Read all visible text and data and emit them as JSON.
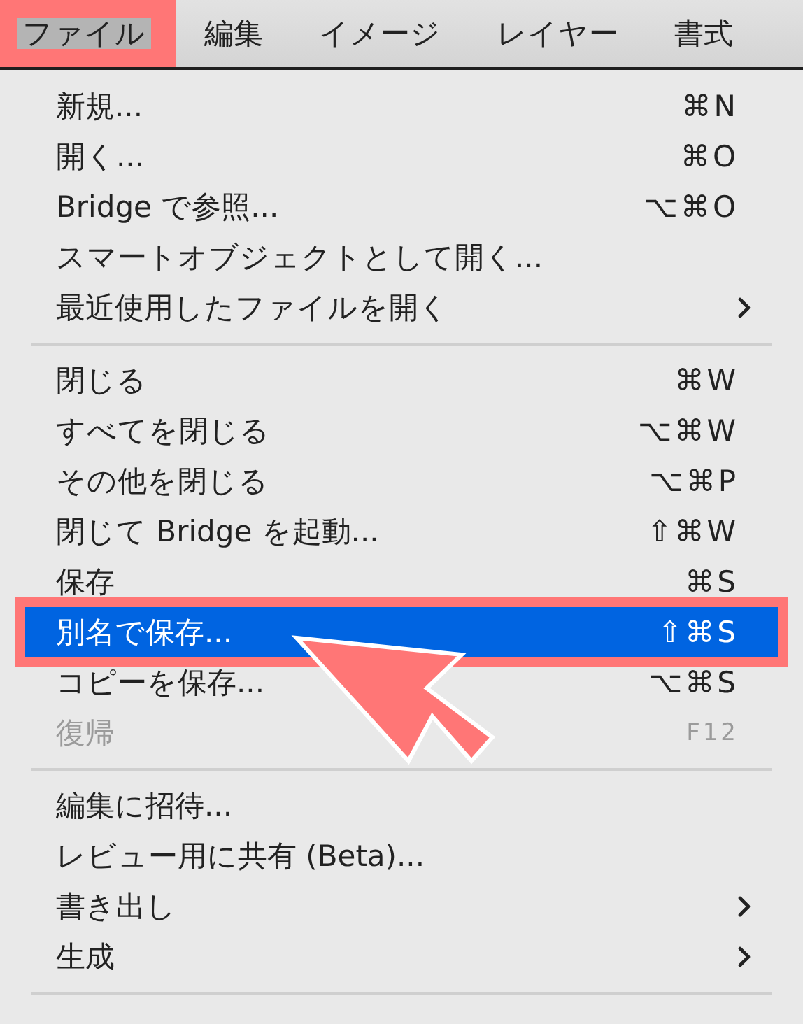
{
  "menu_bar": [
    {
      "label": "ファイル",
      "selected": true
    },
    {
      "label": "編集",
      "selected": false
    },
    {
      "label": "イメージ",
      "selected": false
    },
    {
      "label": "レイヤー",
      "selected": false
    },
    {
      "label": "書式",
      "selected": false
    }
  ],
  "menu": {
    "items": [
      {
        "kind": "item",
        "label": "新規...",
        "shortcut": "⌘N",
        "submenu": false,
        "disabled": false,
        "selected": false
      },
      {
        "kind": "item",
        "label": "開く...",
        "shortcut": "⌘O",
        "submenu": false,
        "disabled": false,
        "selected": false
      },
      {
        "kind": "item",
        "label": "Bridge で参照...",
        "shortcut": "⌥⌘O",
        "submenu": false,
        "disabled": false,
        "selected": false
      },
      {
        "kind": "item",
        "label": "スマートオブジェクトとして開く...",
        "submenu": false,
        "disabled": false,
        "selected": false
      },
      {
        "kind": "item",
        "label": "最近使用したファイルを開く",
        "submenu": true,
        "disabled": false,
        "selected": false
      },
      {
        "kind": "separator"
      },
      {
        "kind": "item",
        "label": "閉じる",
        "shortcut": "⌘W",
        "submenu": false,
        "disabled": false,
        "selected": false
      },
      {
        "kind": "item",
        "label": "すべてを閉じる",
        "shortcut": "⌥⌘W",
        "submenu": false,
        "disabled": false,
        "selected": false
      },
      {
        "kind": "item",
        "label": "その他を閉じる",
        "shortcut": "⌥⌘P",
        "submenu": false,
        "disabled": false,
        "selected": false
      },
      {
        "kind": "item",
        "label": "閉じて Bridge を起動...",
        "shortcut": "⇧⌘W",
        "submenu": false,
        "disabled": false,
        "selected": false
      },
      {
        "kind": "item",
        "label": "保存",
        "shortcut": "⌘S",
        "submenu": false,
        "disabled": false,
        "selected": false
      },
      {
        "kind": "item",
        "label": "別名で保存...",
        "shortcut": "⇧⌘S",
        "submenu": false,
        "disabled": false,
        "selected": true
      },
      {
        "kind": "item",
        "label": "コピーを保存...",
        "shortcut": "⌥⌘S",
        "submenu": false,
        "disabled": false,
        "selected": false
      },
      {
        "kind": "item",
        "label": "復帰",
        "shortcut": "F12",
        "submenu": false,
        "disabled": true,
        "selected": false
      },
      {
        "kind": "separator"
      },
      {
        "kind": "item",
        "label": "編集に招待...",
        "submenu": false,
        "disabled": false,
        "selected": false
      },
      {
        "kind": "item",
        "label": "レビュー用に共有 (Beta)...",
        "submenu": false,
        "disabled": false,
        "selected": false
      },
      {
        "kind": "item",
        "label": "書き出し",
        "submenu": true,
        "disabled": false,
        "selected": false
      },
      {
        "kind": "item",
        "label": "生成",
        "submenu": true,
        "disabled": false,
        "selected": false
      },
      {
        "kind": "separator"
      }
    ]
  }
}
